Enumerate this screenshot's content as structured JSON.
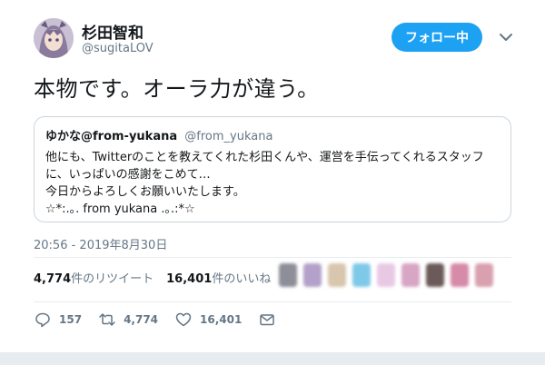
{
  "author": {
    "name": "杉田智和",
    "handle": "@sugitaLOV"
  },
  "follow_button": {
    "label": "フォロー中"
  },
  "tweet": {
    "text": "本物です。オーラ力が違う。",
    "timestamp": "20:56 - 2019年8月30日"
  },
  "quoted_tweet": {
    "name": "ゆかな@from-yukana",
    "handle": "@from_yukana",
    "lines": [
      "他にも、Twitterのことを教えてくれた杉田くんや、運営を手伝ってくれるスタッフ",
      "に、いっぱいの感謝をこめて…",
      "今日からよろしくお願いいたします。",
      "☆*:.｡. from yukana .｡.:*☆"
    ]
  },
  "stats": {
    "retweets_count": "4,774",
    "retweets_label": "件のリツイート",
    "likes_count": "16,401",
    "likes_label": "件のいいね"
  },
  "actions": {
    "reply_count": "157",
    "retweet_count": "4,774",
    "like_count": "16,401"
  },
  "colors": {
    "accent": "#1da1f2",
    "liker_avatars": [
      "#8e8e99",
      "#b3a1c9",
      "#d8c6ae",
      "#7fc9e8",
      "#e8c9e4",
      "#d7a6c4",
      "#6c5a5a",
      "#d68ba8",
      "#d9a0b0"
    ]
  },
  "icons": {
    "reply": "reply-icon",
    "retweet": "retweet-icon",
    "like": "heart-icon",
    "dm": "envelope-icon",
    "menu": "chevron-down-icon"
  }
}
